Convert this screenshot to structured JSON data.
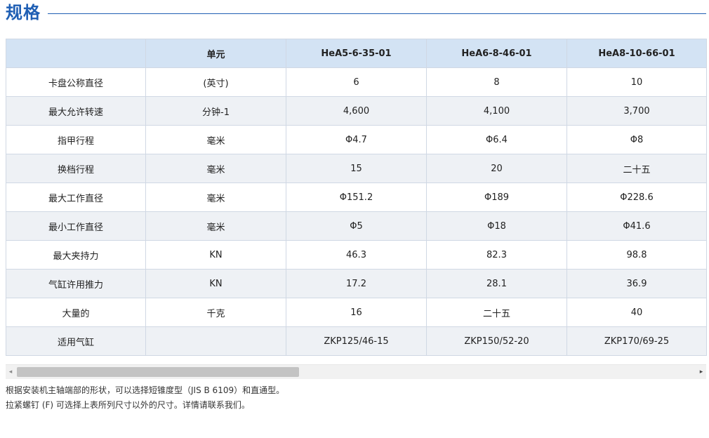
{
  "header": {
    "title": "规格"
  },
  "table": {
    "columns": [
      "",
      "单元",
      "HeA5-6-35-01",
      "HeA6-8-46-01",
      "HeA8-10-66-01"
    ],
    "rows": [
      [
        "卡盘公称直径",
        "(英寸)",
        "6",
        "8",
        "10"
      ],
      [
        "最大允许转速",
        "分钟-1",
        "4,600",
        "4,100",
        "3,700"
      ],
      [
        "指甲行程",
        "毫米",
        "Φ4.7",
        "Φ6.4",
        "Φ8"
      ],
      [
        "换档行程",
        "毫米",
        "15",
        "20",
        "二十五"
      ],
      [
        "最大工作直径",
        "毫米",
        "Φ151.2",
        "Φ189",
        "Φ228.6"
      ],
      [
        "最小工作直径",
        "毫米",
        "Φ5",
        "Φ18",
        "Φ41.6"
      ],
      [
        "最大夹持力",
        "KN",
        "46.3",
        "82.3",
        "98.8"
      ],
      [
        "气缸许用推力",
        "KN",
        "17.2",
        "28.1",
        "36.9"
      ],
      [
        "大量的",
        "千克",
        "16",
        "二十五",
        "40"
      ],
      [
        "适用气缸",
        "",
        "ZKP125/46-15",
        "ZKP150/52-20",
        "ZKP170/69-25"
      ]
    ]
  },
  "scrollbar": {
    "left_icon": "◂",
    "right_icon": "▸"
  },
  "notes": [
    "根据安装机主轴端部的形状，可以选择短锥度型（JIS B 6109）和直通型。",
    "拉紧螺钉 (F) 可选择上表所列尺寸以外的尺寸。详情请联系我们。"
  ],
  "colors": {
    "accent": "#1f5fb4",
    "header_bg": "#d3e3f4",
    "stripe_bg": "#eef1f5"
  }
}
